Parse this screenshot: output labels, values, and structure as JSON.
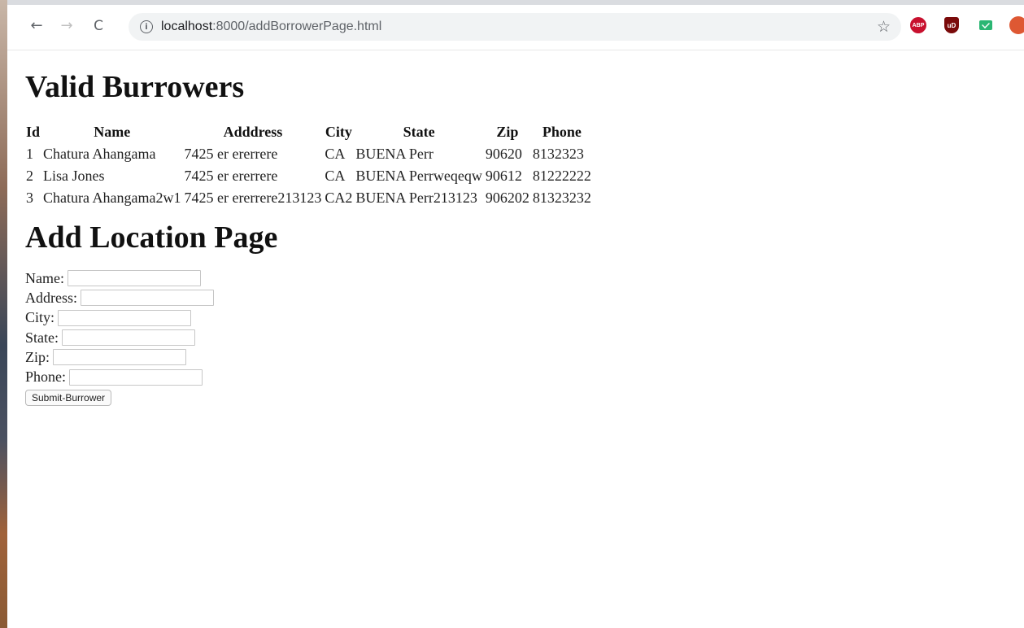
{
  "browser": {
    "url_host": "localhost",
    "url_path": ":8000/addBorrowerPage.html",
    "back_icon": "←",
    "forward_icon": "→",
    "reload_icon": "C",
    "info_icon": "i",
    "star_icon": "☆",
    "extensions": {
      "abp_label": "ABP",
      "ublock_label": "uD",
      "mail_icon": "mail-icon",
      "duck_icon": "duckduckgo-icon"
    }
  },
  "borrowers": {
    "title": "Valid Burrowers",
    "columns": [
      "Id",
      "Name",
      "Adddress",
      "City",
      "State",
      "Zip",
      "Phone"
    ],
    "rows": [
      [
        "1",
        "Chatura Ahangama",
        "7425 er ererrere",
        "CA",
        "BUENA Perr",
        "90620",
        "8132323"
      ],
      [
        "2",
        "Lisa Jones",
        "7425 er ererrere",
        "CA",
        "BUENA Perrweqeqw",
        "90612",
        "81222222"
      ],
      [
        "3",
        "Chatura Ahangama2w1",
        "7425 er ererrere213123",
        "CA2",
        "BUENA Perr213123",
        "906202",
        "81323232"
      ]
    ]
  },
  "location_form": {
    "title": "Add Location Page",
    "fields": {
      "name": {
        "label": "Name:",
        "value": ""
      },
      "address": {
        "label": "Address:",
        "value": ""
      },
      "city": {
        "label": "City:",
        "value": ""
      },
      "state": {
        "label": "State:",
        "value": ""
      },
      "zip": {
        "label": "Zip:",
        "value": ""
      },
      "phone": {
        "label": "Phone:",
        "value": ""
      }
    },
    "submit_label": "Submit-Burrower"
  }
}
